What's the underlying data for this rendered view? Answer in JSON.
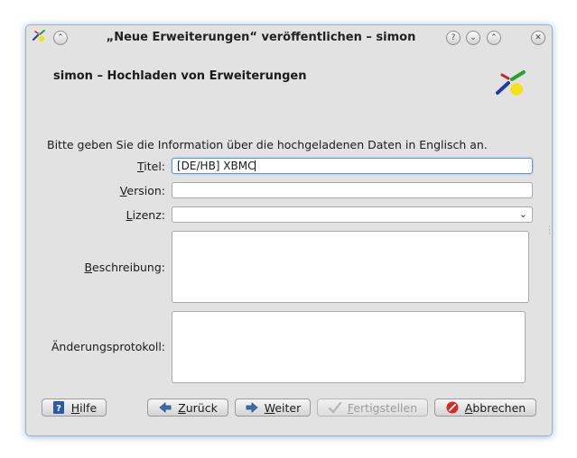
{
  "window": {
    "title": "„Neue Erweiterungen“ veröffentlichen – simon",
    "controls": {
      "shade": "⌃",
      "help": "?",
      "minimize": "⌄",
      "maximize": "⌃",
      "close": "✕"
    }
  },
  "page": {
    "heading": "simon – Hochladen von Erweiterungen",
    "intro": "Bitte geben Sie die Information über die hochgeladenen Daten in Englisch an."
  },
  "form": {
    "title_label_u": "T",
    "title_label_rest": "itel:",
    "title_value": "[DE/HB] XBMC",
    "version_label_u": "V",
    "version_label_rest": "ersion:",
    "version_value": "",
    "license_label_u": "L",
    "license_label_rest": "izenz:",
    "license_value": "",
    "description_label_u": "B",
    "description_label_rest": "eschreibung:",
    "changelog_label": "Änderungsprotokoll:"
  },
  "buttons": {
    "help_u": "H",
    "help_rest": "ilfe",
    "back_u": "Z",
    "back_rest": "urück",
    "next_u": "W",
    "next_rest": "eiter",
    "finish_u": "F",
    "finish_rest": "ertigstellen",
    "cancel_u": "A",
    "cancel_rest": "bbrechen"
  },
  "colors": {
    "window_bg": "#e2e2e2",
    "focus_border": "#5e98c8",
    "help_icon": "#2a5aa8",
    "arrow_icon": "#3a6fb0",
    "cancel_icon": "#d42a2a"
  }
}
